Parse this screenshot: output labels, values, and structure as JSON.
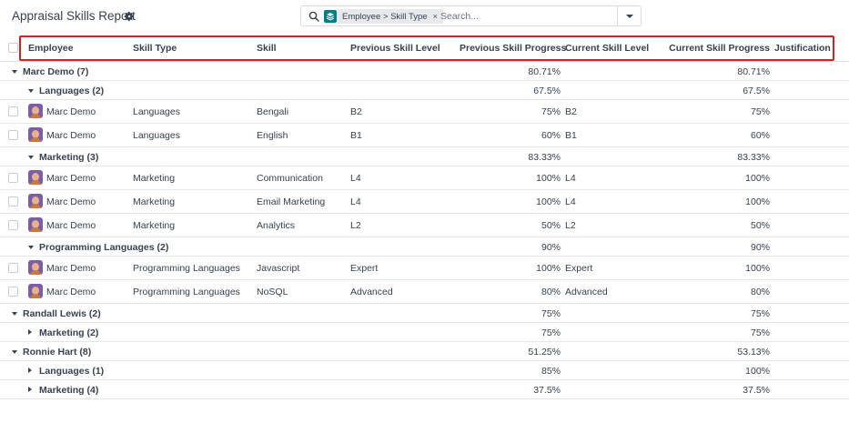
{
  "header": {
    "title": "Appraisal Skills Report",
    "settings_icon": "gear-icon"
  },
  "search": {
    "search_icon": "search-icon",
    "facet_icon": "stack-layers-icon",
    "facet_label": "Employee > Skill Type",
    "facet_remove": "×",
    "placeholder": "Search...",
    "toggle_icon": "caret-down-icon"
  },
  "table": {
    "columns": [
      "Employee",
      "Skill Type",
      "Skill",
      "Previous Skill Level",
      "Previous Skill Progress",
      "Current Skill Level",
      "Current Skill Progress",
      "Justification"
    ],
    "rows": [
      {
        "kind": "group",
        "level": 0,
        "open": true,
        "label": "Marc Demo (7)",
        "prev_progress": "80.71%",
        "curr_progress": "80.71%"
      },
      {
        "kind": "group",
        "level": 1,
        "open": true,
        "label": "Languages (2)",
        "prev_progress": "67.5%",
        "curr_progress": "67.5%"
      },
      {
        "kind": "record",
        "employee": "Marc Demo",
        "skill_type": "Languages",
        "skill": "Bengali",
        "prev_level": "B2",
        "prev_progress": "75%",
        "curr_level": "B2",
        "curr_progress": "75%"
      },
      {
        "kind": "record",
        "employee": "Marc Demo",
        "skill_type": "Languages",
        "skill": "English",
        "prev_level": "B1",
        "prev_progress": "60%",
        "curr_level": "B1",
        "curr_progress": "60%"
      },
      {
        "kind": "group",
        "level": 1,
        "open": true,
        "label": "Marketing (3)",
        "prev_progress": "83.33%",
        "curr_progress": "83.33%"
      },
      {
        "kind": "record",
        "employee": "Marc Demo",
        "skill_type": "Marketing",
        "skill": "Communication",
        "prev_level": "L4",
        "prev_progress": "100%",
        "curr_level": "L4",
        "curr_progress": "100%"
      },
      {
        "kind": "record",
        "employee": "Marc Demo",
        "skill_type": "Marketing",
        "skill": "Email Marketing",
        "prev_level": "L4",
        "prev_progress": "100%",
        "curr_level": "L4",
        "curr_progress": "100%"
      },
      {
        "kind": "record",
        "employee": "Marc Demo",
        "skill_type": "Marketing",
        "skill": "Analytics",
        "prev_level": "L2",
        "prev_progress": "50%",
        "curr_level": "L2",
        "curr_progress": "50%"
      },
      {
        "kind": "group",
        "level": 1,
        "open": true,
        "label": "Programming Languages (2)",
        "prev_progress": "90%",
        "curr_progress": "90%"
      },
      {
        "kind": "record",
        "employee": "Marc Demo",
        "skill_type": "Programming Languages",
        "skill": "Javascript",
        "prev_level": "Expert",
        "prev_progress": "100%",
        "curr_level": "Expert",
        "curr_progress": "100%"
      },
      {
        "kind": "record",
        "employee": "Marc Demo",
        "skill_type": "Programming Languages",
        "skill": "NoSQL",
        "prev_level": "Advanced",
        "prev_progress": "80%",
        "curr_level": "Advanced",
        "curr_progress": "80%"
      },
      {
        "kind": "group",
        "level": 0,
        "open": true,
        "label": "Randall Lewis (2)",
        "prev_progress": "75%",
        "curr_progress": "75%"
      },
      {
        "kind": "group",
        "level": 1,
        "open": false,
        "label": "Marketing (2)",
        "prev_progress": "75%",
        "curr_progress": "75%"
      },
      {
        "kind": "group",
        "level": 0,
        "open": true,
        "label": "Ronnie Hart (8)",
        "prev_progress": "51.25%",
        "curr_progress": "53.13%"
      },
      {
        "kind": "group",
        "level": 1,
        "open": false,
        "label": "Languages (1)",
        "prev_progress": "85%",
        "curr_progress": "100%"
      },
      {
        "kind": "group",
        "level": 1,
        "open": false,
        "label": "Marketing (4)",
        "prev_progress": "37.5%",
        "curr_progress": "37.5%"
      }
    ]
  },
  "colors": {
    "highlight_border": "#d42121",
    "facet_icon_bg": "#017e84",
    "text": "#374151"
  }
}
